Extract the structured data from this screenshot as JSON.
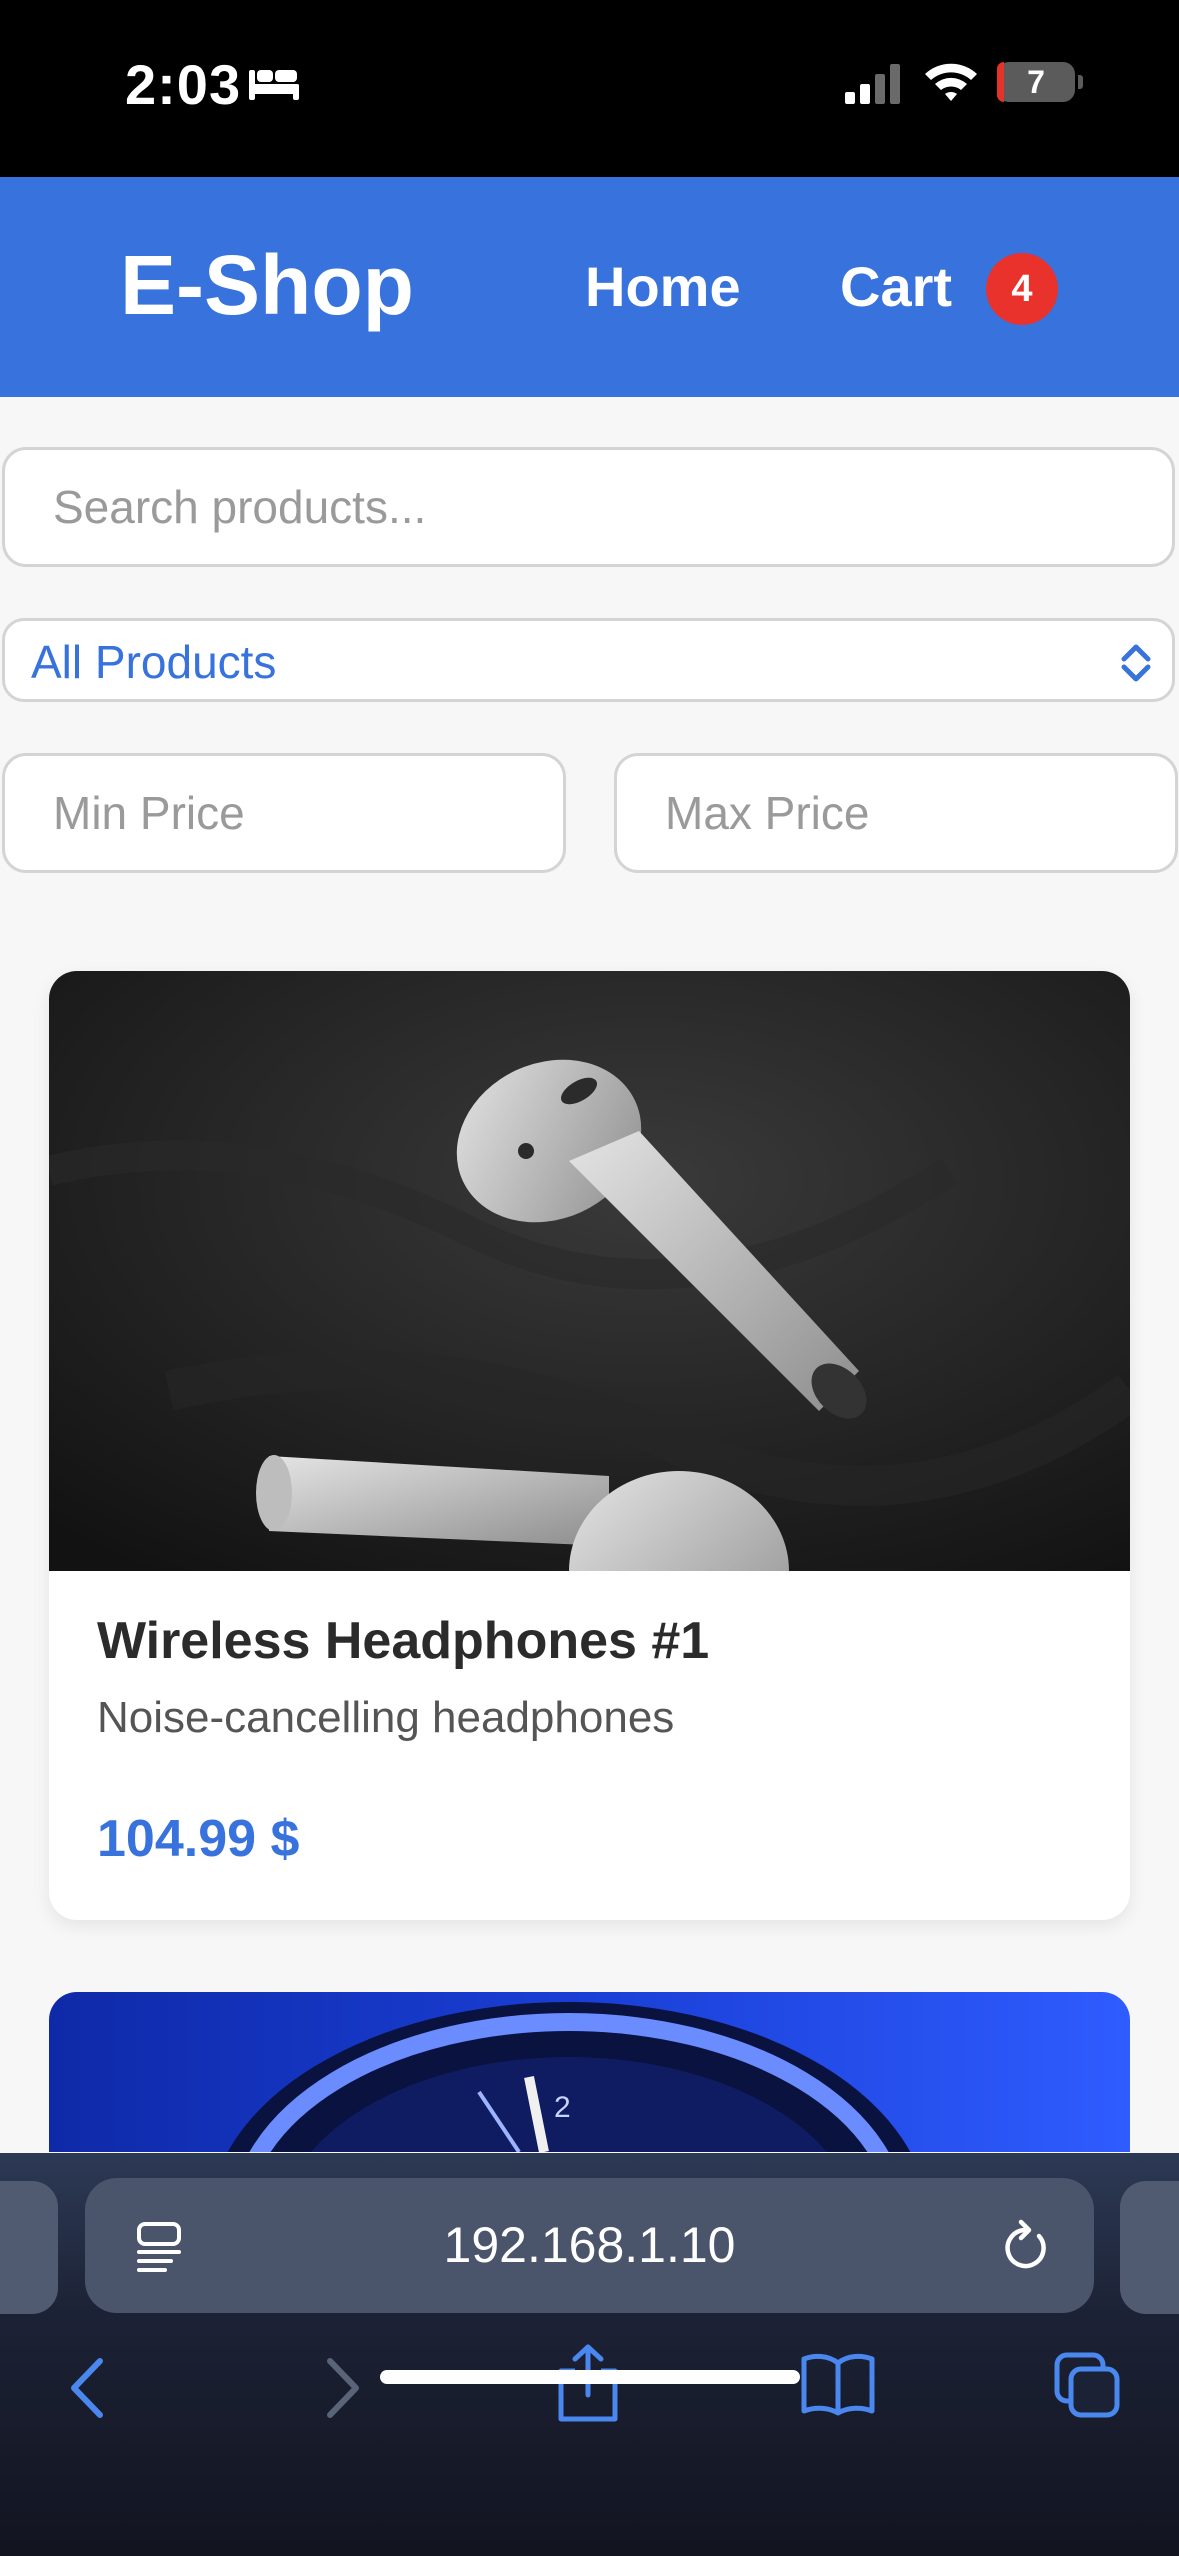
{
  "status_bar": {
    "time": "2:03",
    "battery": "7"
  },
  "header": {
    "brand": "E-Shop",
    "nav_home": "Home",
    "nav_cart": "Cart",
    "cart_count": "4"
  },
  "filters": {
    "search_placeholder": "Search products...",
    "category_selected": "All Products",
    "min_price_placeholder": "Min Price",
    "max_price_placeholder": "Max Price"
  },
  "products": [
    {
      "name": "Wireless Headphones #1",
      "description": "Noise-cancelling headphones",
      "price": "104.99 $"
    }
  ],
  "browser": {
    "url": "192.168.1.10"
  },
  "colors": {
    "accent": "#3872dd",
    "badge": "#e8322b",
    "status_bar": "#000000"
  },
  "icons": [
    "sleep-icon",
    "signal-icon",
    "wifi-icon",
    "battery-icon",
    "chevron-updown-icon",
    "reader-icon",
    "reload-icon",
    "back-icon",
    "forward-icon",
    "share-icon",
    "bookmarks-icon",
    "tabs-icon"
  ]
}
